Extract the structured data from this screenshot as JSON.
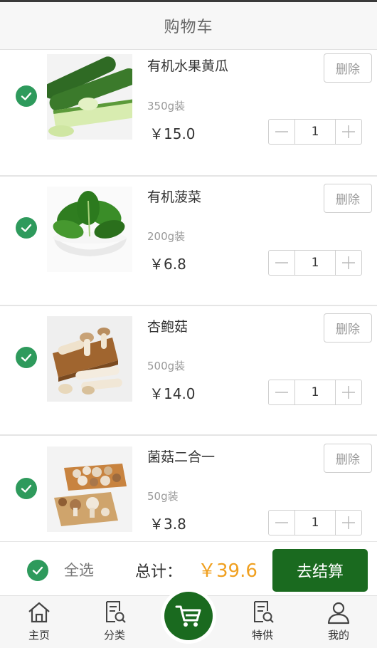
{
  "header": {
    "title": "购物车"
  },
  "items": [
    {
      "name": "有机水果黄瓜",
      "spec": "350g装",
      "price": "￥15.0",
      "qty": "1",
      "delete_label": "删除",
      "image_icon": "cucumber-image"
    },
    {
      "name": "有机菠菜",
      "spec": "200g装",
      "price": "￥6.8",
      "qty": "1",
      "delete_label": "删除",
      "image_icon": "spinach-image"
    },
    {
      "name": "杏鲍菇",
      "spec": "500g装",
      "price": "￥14.0",
      "qty": "1",
      "delete_label": "删除",
      "image_icon": "king-oyster-mushroom-image"
    },
    {
      "name": "菌菇二合一",
      "spec": "50g装",
      "price": "￥3.8",
      "qty": "1",
      "delete_label": "删除",
      "image_icon": "mushroom-combo-image"
    }
  ],
  "summary": {
    "select_all": "全选",
    "total_label": "总计：",
    "total_value": "￥39.6",
    "checkout": "去结算"
  },
  "tabs": [
    {
      "label": "主页",
      "icon": "home-icon"
    },
    {
      "label": "分类",
      "icon": "category-search-icon"
    },
    {
      "label": "",
      "icon": "cart-icon"
    },
    {
      "label": "特供",
      "icon": "special-search-icon"
    },
    {
      "label": "我的",
      "icon": "user-icon"
    }
  ],
  "colors": {
    "accent_green": "#1a6a1f",
    "check_green": "#2e9a5c",
    "total_orange": "#f0a020"
  }
}
